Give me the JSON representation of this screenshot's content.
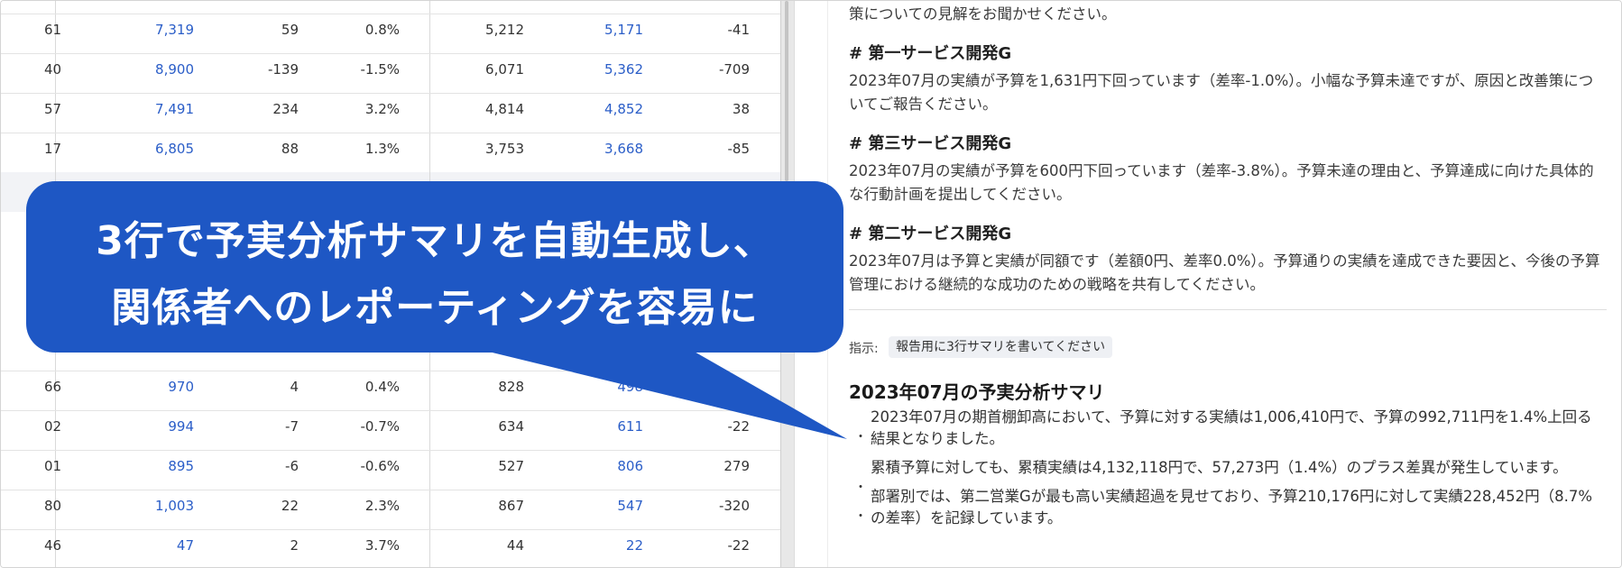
{
  "sheet": {
    "rows": [
      [
        "61",
        "7,319",
        "59",
        "0.8%",
        "5,212",
        "5,171",
        "-41"
      ],
      [
        "40",
        "8,900",
        "-139",
        "-1.5%",
        "6,071",
        "5,362",
        "-709"
      ],
      [
        "57",
        "7,491",
        "234",
        "3.2%",
        "4,814",
        "4,852",
        "38"
      ],
      [
        "17",
        "6,805",
        "88",
        "1.3%",
        "3,753",
        "3,668",
        "-85"
      ],
      [
        "66",
        "970",
        "4",
        "0.4%",
        "828",
        "498",
        ""
      ],
      [
        "02",
        "994",
        "-7",
        "-0.7%",
        "634",
        "611",
        "-22"
      ],
      [
        "01",
        "895",
        "-6",
        "-0.6%",
        "527",
        "806",
        "279"
      ],
      [
        "80",
        "1,003",
        "22",
        "2.3%",
        "867",
        "547",
        "-320"
      ],
      [
        "46",
        "47",
        "2",
        "3.7%",
        "44",
        "22",
        "-22"
      ]
    ]
  },
  "report": {
    "intro_tail": "策についての見解をお聞かせください。",
    "sections": [
      {
        "heading": "# 第一サービス開発G",
        "body": "2023年07月の実績が予算を1,631円下回っています（差率-1.0%）。小幅な予算未達ですが、原因と改善策についてご報告ください。"
      },
      {
        "heading": "# 第三サービス開発G",
        "body": "2023年07月の実績が予算を600円下回っています（差率-3.8%）。予算未達の理由と、予算達成に向けた具体的な行動計画を提出してください。"
      },
      {
        "heading": "# 第二サービス開発G",
        "body": "2023年07月は予算と実績が同額です（差額0円、差率0.0%）。予算通りの実績を達成できた要因と、今後の予算管理における継続的な成功のための戦略を共有してください。"
      }
    ],
    "instruction_label": "指示:",
    "instruction_text": "報告用に3行サマリを書いてください",
    "summary_title": "2023年07月の予実分析サマリ",
    "summary": [
      "2023年07月の期首棚卸高において、予算に対する実績は1,006,410円で、予算の992,711円を1.4%上回る結果となりました。",
      "累積予算に対しても、累積実績は4,132,118円で、57,273円（1.4%）のプラス差異が発生しています。",
      "部署別では、第二営業Gが最も高い実績超過を見せており、予算210,176円に対して実績228,452円（8.7%の差率）を記録しています。"
    ],
    "bullet_glyph": "・"
  },
  "callout": {
    "line1": "3行で予実分析サマリを自動生成し、",
    "line2": "関係者へのレポーティングを容易に",
    "color": "#1e57c4"
  },
  "colors": {
    "link": "#2b5ec8",
    "divider": "#e8e8e8"
  }
}
